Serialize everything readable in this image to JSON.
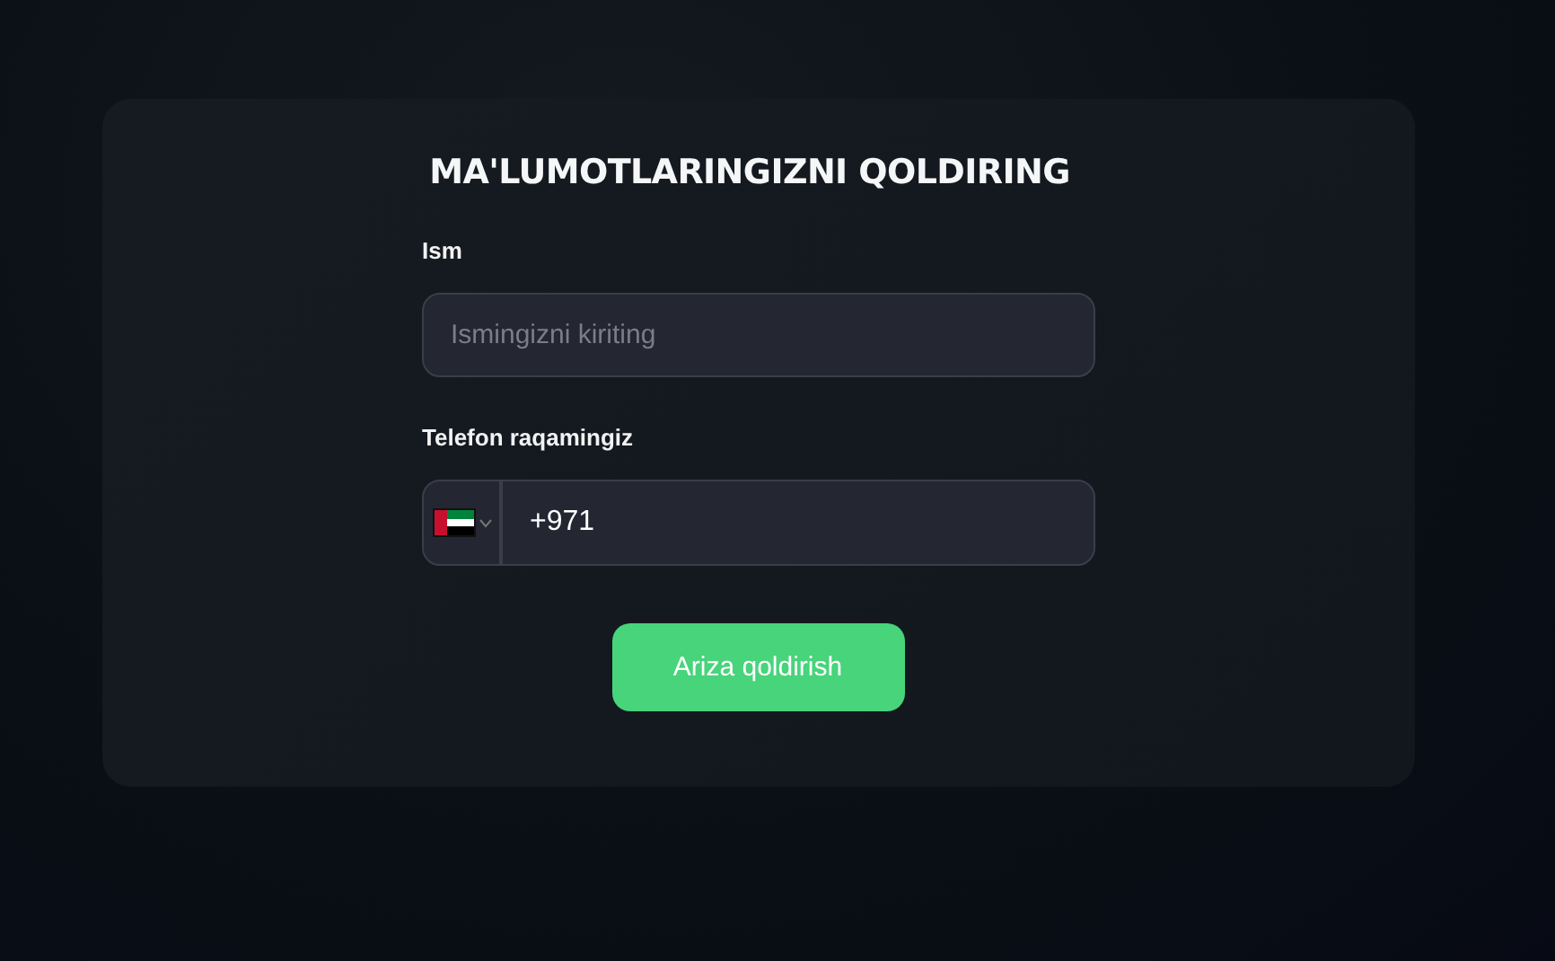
{
  "form": {
    "title": "MA'LUMOTLARINGIZNI QOLDIRING",
    "name_field": {
      "label": "Ism",
      "placeholder": "Ismingizni kiriting"
    },
    "phone_field": {
      "label": "Telefon raqamingiz",
      "value": "+971"
    },
    "submit": "Ariza qoldirish"
  }
}
